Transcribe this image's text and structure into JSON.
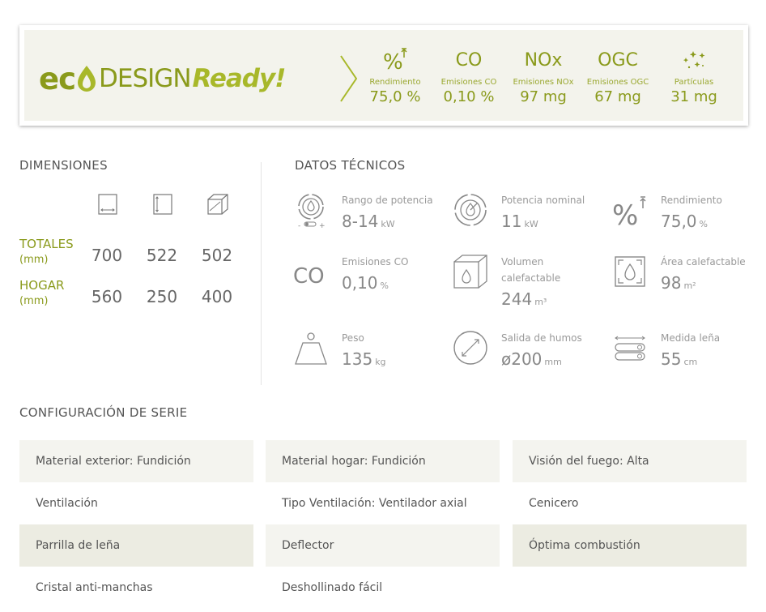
{
  "ecodesign": {
    "logo": {
      "eco": "ec",
      "design": "DESIGN",
      "ready": "Ready!"
    },
    "metrics": [
      {
        "symbol": "%",
        "label": "Rendimiento",
        "value": "75,0 %"
      },
      {
        "symbol": "CO",
        "label": "Emisiones CO",
        "value": "0,10 %"
      },
      {
        "symbol": "NOx",
        "label": "Emisiones NOx",
        "value": "97 mg"
      },
      {
        "symbol": "OGC",
        "label": "Emisiones OGC",
        "value": "67 mg"
      },
      {
        "symbol": "particles-icon",
        "label": "Partículas",
        "value": "31 mg"
      }
    ]
  },
  "dimensiones": {
    "title": "DIMENSIONES",
    "icons": [
      "width-icon",
      "height-icon",
      "depth-icon"
    ],
    "rows": [
      {
        "label": "TOTALES",
        "unit": "(mm)",
        "values": [
          "700",
          "522",
          "502"
        ]
      },
      {
        "label": "HOGAR",
        "unit": "(mm)",
        "values": [
          "560",
          "250",
          "400"
        ]
      }
    ]
  },
  "datos_tecnicos": {
    "title": "DATOS TÉCNICOS",
    "items": [
      {
        "icon": "power-range-icon",
        "label": "Rango de potencia",
        "value": "8-14",
        "unit": "kW"
      },
      {
        "icon": "nominal-power-icon",
        "label": "Potencia nominal",
        "value": "11",
        "unit": "kW"
      },
      {
        "icon": "efficiency-icon",
        "label": "Rendimiento",
        "value": "75,0",
        "unit": "%"
      },
      {
        "icon": "co-icon",
        "label": "Emisiones CO",
        "value": "0,10",
        "unit": "%"
      },
      {
        "icon": "heated-volume-icon",
        "label": "Volumen\ncalefactable",
        "value": "244",
        "unit": "m³"
      },
      {
        "icon": "heated-area-icon",
        "label": "Área calefactable",
        "value": "98",
        "unit": "m²"
      },
      {
        "icon": "weight-icon",
        "label": "Peso",
        "value": "135",
        "unit": "kg"
      },
      {
        "icon": "flue-outlet-icon",
        "label": "Salida de humos",
        "value": "ø200",
        "unit": "mm"
      },
      {
        "icon": "log-size-icon",
        "label": "Medida leña",
        "value": "55",
        "unit": "cm"
      }
    ],
    "co_symbol": "CO",
    "pct_symbol": "%"
  },
  "configuracion": {
    "title": "CONFIGURACIÓN DE SERIE",
    "items": [
      "Material exterior: Fundición",
      "Material hogar: Fundición",
      "Visión del fuego: Alta",
      "Ventilación",
      "Tipo Ventilación: Ventilador axial",
      "Cenicero",
      "Parrilla de leña",
      "Deflector",
      "Óptima combustión",
      "Cristal anti-manchas",
      "Deshollinado fácil"
    ]
  },
  "colors": {
    "accent": "#8a9a1b",
    "accent_light": "#a8b82a",
    "row_shade_light": "#f4f4ef",
    "row_shade_dark": "#ecece2"
  }
}
